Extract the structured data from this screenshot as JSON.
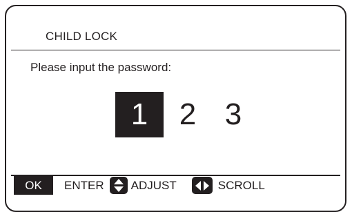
{
  "screen": {
    "title": "CHILD LOCK",
    "prompt": "Please input the password:"
  },
  "password": {
    "digits": [
      "1",
      "2",
      "3"
    ],
    "selected_index": 0
  },
  "footer": {
    "ok_label": "OK",
    "enter_label": "ENTER",
    "adjust_icon": "up-down-arrows-icon",
    "adjust_label": "ADJUST",
    "scroll_icon": "left-right-arrows-icon",
    "scroll_label": "SCROLL"
  },
  "colors": {
    "foreground": "#231f20",
    "background": "#ffffff"
  }
}
